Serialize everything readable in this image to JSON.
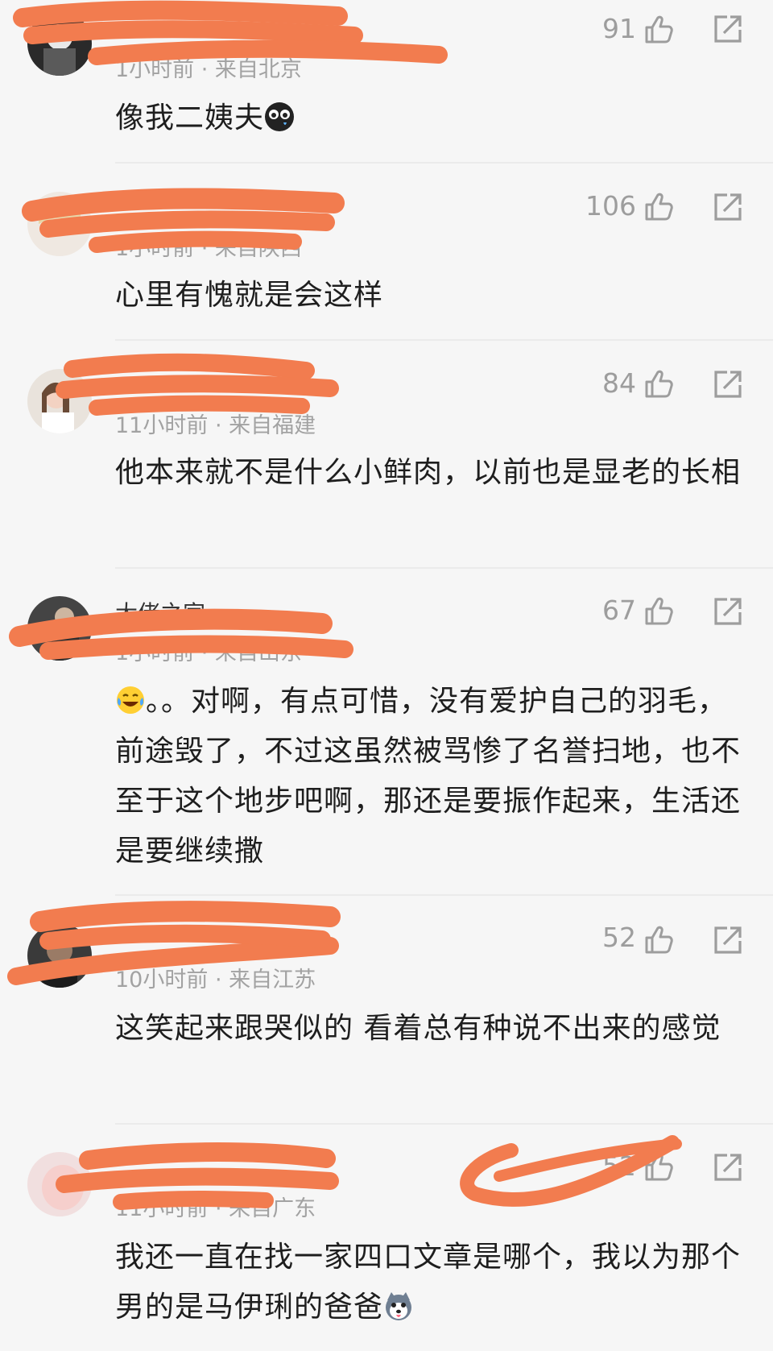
{
  "comments": [
    {
      "username": "",
      "meta": "1小时前 · 来自北京",
      "likes": "91",
      "text": "像我二姨夫",
      "emoji": "crying-face-emoji"
    },
    {
      "username": "",
      "meta": "1小时前 · 来自陕西",
      "likes": "106",
      "text": "心里有愧就是会这样"
    },
    {
      "username": "",
      "meta": "11小时前 · 来自福建",
      "likes": "84",
      "text": "他本来就不是什么小鲜肉，以前也是显老的长相"
    },
    {
      "username": "大佬之家",
      "meta": "1小时前 · 来自山东",
      "likes": "67",
      "text": "。。对啊，有点可惜，没有爱护自己的羽毛，前途毁了，不过这虽然被骂惨了名誉扫地，也不至于这个地步吧啊，那还是要振作起来，生活还是要继续撒",
      "emoji": "laughing-crying-emoji"
    },
    {
      "username": "",
      "meta": "10小时前 · 来自江苏",
      "likes": "52",
      "text": "这笑起来跟哭似的 看着总有种说不出来的感觉"
    },
    {
      "username": "",
      "meta": "11小时前 · 来自广东",
      "likes": "52",
      "text": "我还一直在找一家四口文章是哪个，我以为那个男的是马伊琍的爸爸",
      "emoji": "husky-dog-emoji"
    }
  ],
  "colors": {
    "background": "#f6f6f6",
    "scribble": "#f27c4f",
    "meta_text": "#a2a2a2",
    "icon": "#9d9d9d"
  },
  "icons": [
    "thumbs-up-icon",
    "share-icon"
  ]
}
